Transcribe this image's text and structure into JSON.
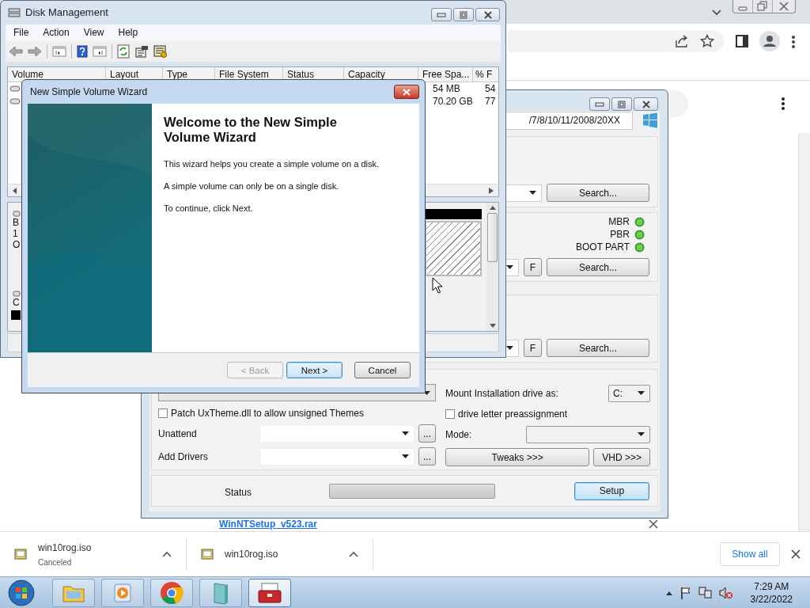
{
  "browser": {
    "page": {
      "link": "WinNTSetup_v523.rar"
    },
    "downloads": [
      {
        "name": "win10rog.iso",
        "status": "Canceled"
      },
      {
        "name": "win10rog.iso"
      }
    ],
    "show_all": "Show all"
  },
  "disk_management": {
    "title": "Disk Management",
    "menu": [
      "File",
      "Action",
      "View",
      "Help"
    ],
    "columns": [
      "Volume",
      "Layout",
      "Type",
      "File System",
      "Status",
      "Capacity",
      "Free Spa...",
      "% F"
    ],
    "rows": [
      {
        "free_space": "54 MB",
        "percent_free": "54"
      },
      {
        "free_space": "70.20 GB",
        "percent_free": "77"
      }
    ],
    "disks": [
      {
        "lines": [
          "B",
          "1",
          "O"
        ],
        "kind": "basic"
      },
      {
        "lines": [
          "C"
        ],
        "kind": "cdrom"
      }
    ]
  },
  "winntsetup": {
    "path_text": "/7/8/10/11/2008/20XX",
    "sections": [
      {
        "search": "Search..."
      },
      {
        "boot_flags": [
          "MBR",
          "PBR",
          "BOOT PART"
        ],
        "format": "F",
        "search": "Search..."
      },
      {
        "format": "F",
        "search": "Search..."
      }
    ],
    "options": {
      "mount_label": "Mount Installation drive as:",
      "drive": "C:",
      "patch": {
        "label": "Patch UxTheme.dll to allow unsigned Themes",
        "checked": false
      },
      "preassign": {
        "label": "drive letter preassignment",
        "checked": false
      },
      "unattend_label": "Unattend",
      "unattend_browse": "...",
      "mode_label": "Mode:",
      "drivers_label": "Add Drivers",
      "drivers_browse": "...",
      "tweaks": "Tweaks >>>",
      "vhd": "VHD >>>"
    },
    "status": {
      "label": "Status",
      "level": 0
    },
    "setup": "Setup"
  },
  "wizard": {
    "title": "New Simple Volume Wizard",
    "heading": "Welcome to the New Simple Volume Wizard",
    "paragraphs": [
      "This wizard helps you create a simple volume on a disk.",
      "A simple volume can only be on a single disk.",
      "To continue, click Next."
    ],
    "buttons": [
      {
        "label": "< Back",
        "disabled": true,
        "default": false
      },
      {
        "label": "Next >",
        "disabled": false,
        "default": true
      },
      {
        "label": "Cancel",
        "disabled": false,
        "default": false
      }
    ]
  },
  "taskbar": {
    "apps": [
      {
        "kind": "explorer",
        "selected": false
      },
      {
        "kind": "media",
        "selected": false
      },
      {
        "kind": "chrome",
        "selected": false
      },
      {
        "kind": "book",
        "selected": false
      },
      {
        "kind": "toolbox",
        "selected": true
      }
    ],
    "clock": {
      "time": "7:29 AM",
      "date": "3/22/2022"
    }
  }
}
